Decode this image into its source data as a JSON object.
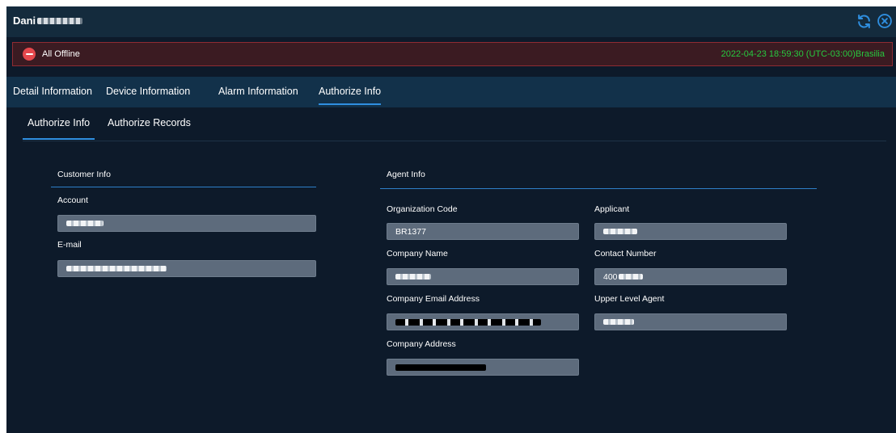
{
  "header": {
    "title_prefix": "Dani",
    "refresh_icon": "refresh-icon",
    "close_icon": "close-circle-icon"
  },
  "status": {
    "label": "All Offline",
    "timestamp": "2022-04-23 18:59:30 (UTC-03:00)Brasilia",
    "color_offline": "#e5484d",
    "color_time": "#27c93f"
  },
  "main_tabs": [
    {
      "label": "Detail Information"
    },
    {
      "label": "Device Information"
    },
    {
      "label": "Alarm Information"
    },
    {
      "label": "Authorize Info",
      "active": true
    }
  ],
  "sub_tabs": [
    {
      "label": "Authorize Info",
      "active": true
    },
    {
      "label": "Authorize Records"
    }
  ],
  "customer_info": {
    "title": "Customer Info",
    "account_label": "Account",
    "email_label": "E-mail"
  },
  "agent_info": {
    "title": "Agent Info",
    "organization_code_label": "Organization Code",
    "organization_code_value": "BR1377",
    "applicant_label": "Applicant",
    "company_name_label": "Company Name",
    "contact_number_label": "Contact Number",
    "contact_number_prefix": "400",
    "company_email_label": "Company Email Address",
    "upper_level_agent_label": "Upper Level Agent",
    "company_address_label": "Company Address"
  },
  "accent_color": "#2f8fe0"
}
